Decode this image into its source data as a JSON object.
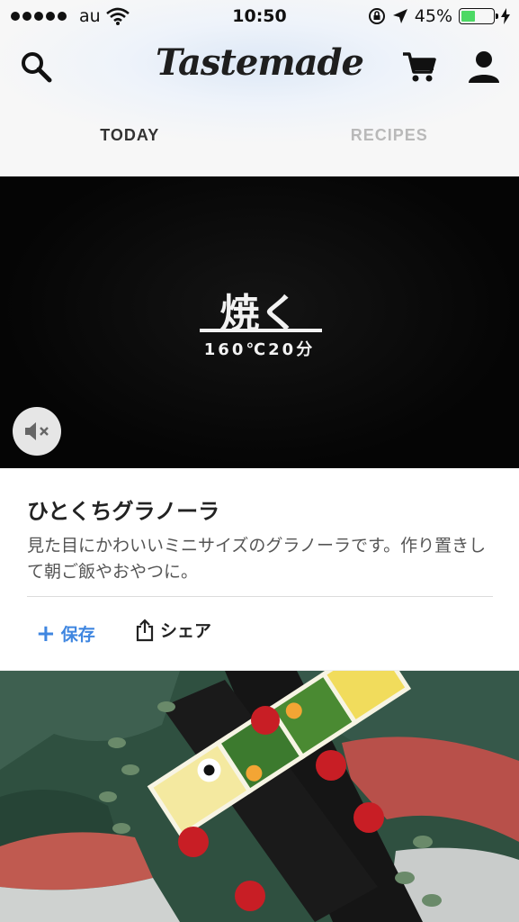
{
  "status_bar": {
    "carrier": "au",
    "time": "10:50",
    "battery_percent": "45%",
    "battery_level": 0.45
  },
  "header": {
    "logo": "Tastemade",
    "icons": [
      "search-icon",
      "cart-icon",
      "profile-icon"
    ]
  },
  "tabs": [
    {
      "label": "TODAY",
      "active": true
    },
    {
      "label": "RECIPES",
      "active": false
    }
  ],
  "card": {
    "video_title": "焼く",
    "video_subtitle": "160℃20分",
    "mute_icon": "speaker-muted-icon",
    "title": "ひとくちグラノーラ",
    "description": "見た目にかわいいミニサイズのグラノーラです。作り置きして朝ご飯やおやつに。",
    "save_label": "保存",
    "share_label": "シェア"
  },
  "colors": {
    "accent": "#3f86e0",
    "inactive_tab": "#b9b9b9",
    "battery": "#4cd964"
  }
}
